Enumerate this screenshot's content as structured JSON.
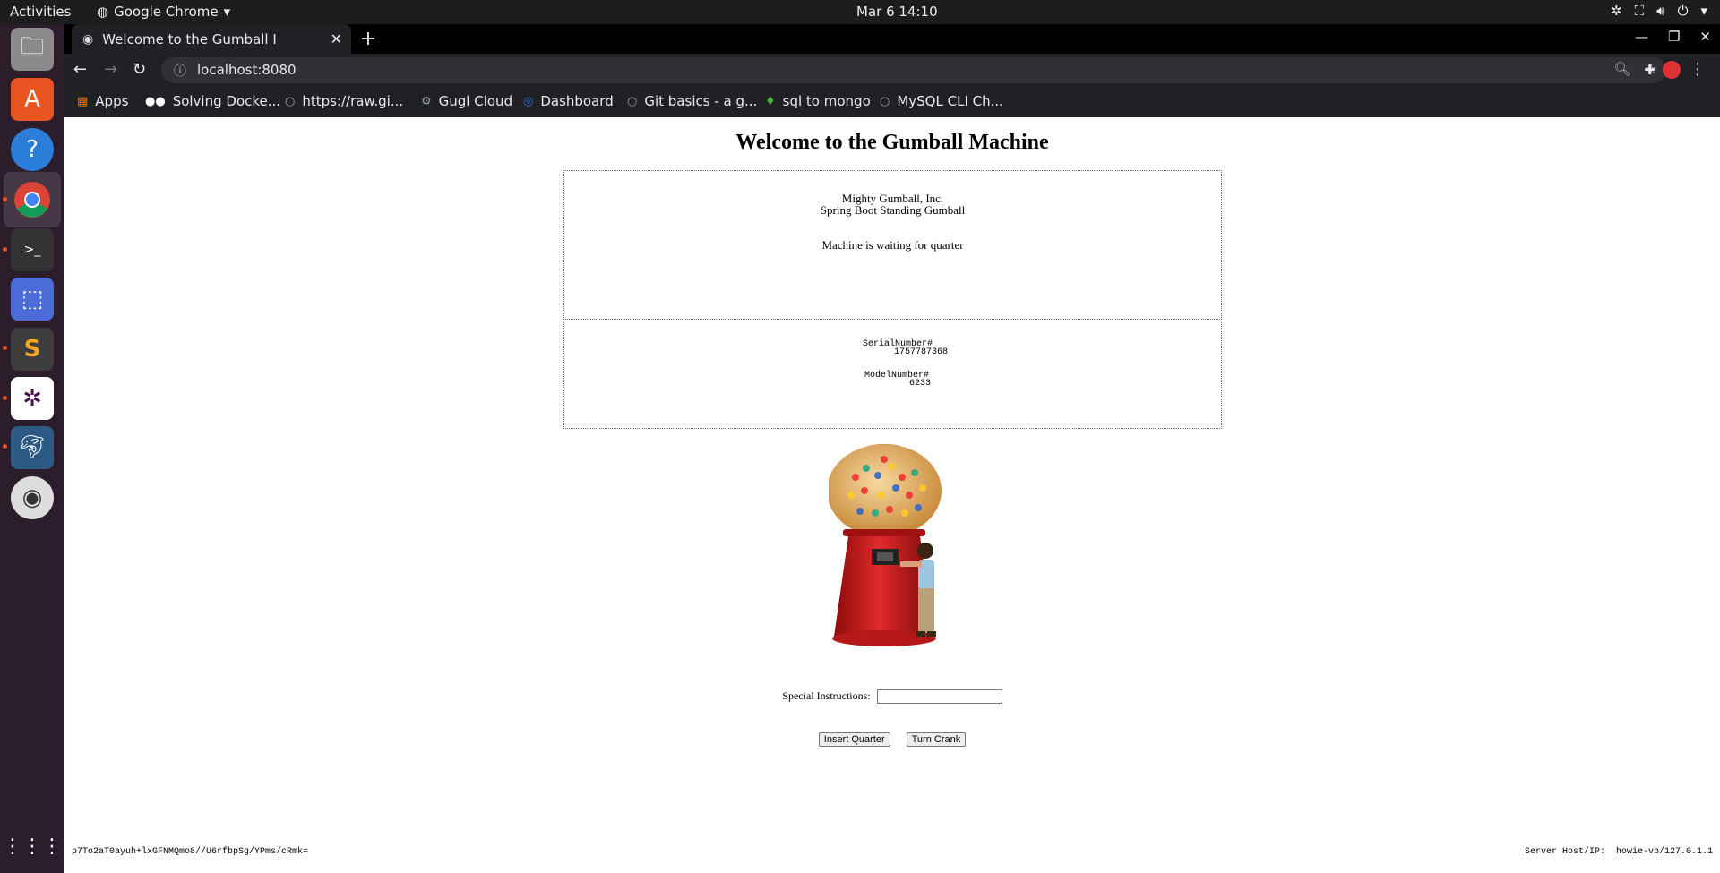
{
  "topbar": {
    "activities": "Activities",
    "app_name": "Google Chrome",
    "clock": "Mar 6  14:10"
  },
  "dock": {
    "items": [
      "files-icon",
      "software-icon",
      "help-icon",
      "chrome-icon",
      "terminal-icon",
      "screenshot-icon",
      "sublime-icon",
      "slack-icon",
      "mysql-workbench-icon",
      "disc-icon",
      "app-grid-icon"
    ]
  },
  "browser": {
    "tab_title": "Welcome to the Gumball I",
    "url": "localhost:8080",
    "bookmarks": [
      {
        "label": "Apps"
      },
      {
        "label": "Solving Docke..."
      },
      {
        "label": "https://raw.gi..."
      },
      {
        "label": "Gugl Cloud"
      },
      {
        "label": "Dashboard"
      },
      {
        "label": "Git basics - a g..."
      },
      {
        "label": "sql to mongo"
      },
      {
        "label": "MySQL CLI Ch..."
      }
    ]
  },
  "page": {
    "heading": "Welcome to the Gumball Machine",
    "company": "Mighty Gumball, Inc.",
    "product": "Spring Boot Standing Gumball",
    "state": "Machine is waiting for quarter",
    "serial_label": "SerialNumber#",
    "serial_value": "1757787368",
    "model_label": "ModelNumber#",
    "model_value": "6233",
    "instructions_label": "Special Instructions:",
    "instructions_value": "",
    "insert_button": "Insert Quarter",
    "crank_button": "Turn Crank",
    "hash": "p7To2aT0ayuh+lxGFNMQmo8//U6rfbpSg/YPms/cRmk=",
    "server_label": "Server Host/IP:",
    "server_value": "howie-vb/127.0.1.1"
  },
  "colors": {
    "chrome_dark": "#202124",
    "dock_bg": "#2c1d2b",
    "gumball_red": "#d21f1f"
  }
}
